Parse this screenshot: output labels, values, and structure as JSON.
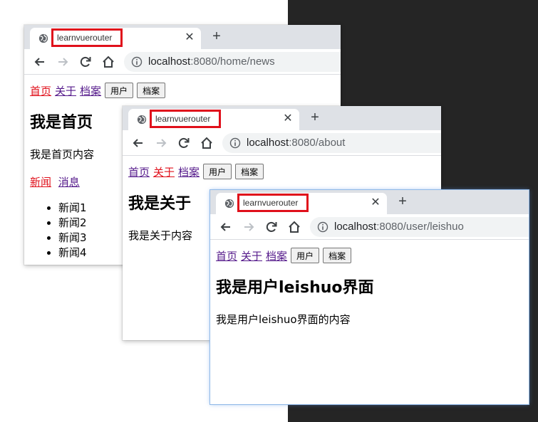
{
  "windows": [
    {
      "id": "home",
      "tab_title": "learnvuerouter",
      "url_host": "localhost",
      "url_rest": ":8080/home/news",
      "nav": {
        "home": "首页",
        "about": "关于",
        "archive": "档案",
        "user": "用户",
        "archive_btn": "档案"
      },
      "heading": "我是首页",
      "paragraph": "我是首页内容",
      "sub_nav": {
        "news": "新闻",
        "messages": "消息"
      },
      "news_items": [
        "新闻1",
        "新闻2",
        "新闻3",
        "新闻4"
      ]
    },
    {
      "id": "about",
      "tab_title": "learnvuerouter",
      "url_host": "localhost",
      "url_rest": ":8080/about",
      "nav": {
        "home": "首页",
        "about": "关于",
        "archive": "档案",
        "user": "用户",
        "archive_btn": "档案"
      },
      "heading": "我是关于",
      "paragraph": "我是关于内容"
    },
    {
      "id": "user",
      "tab_title": "learnvuerouter",
      "url_host": "localhost",
      "url_rest": ":8080/user/leishuo",
      "nav": {
        "home": "首页",
        "about": "关于",
        "archive": "档案",
        "user": "用户",
        "archive_btn": "档案"
      },
      "heading": "我是用户leishuo界面",
      "paragraph": "我是用户leishuo界面的内容"
    }
  ],
  "icons": {
    "tab_favicon": "globe-icon",
    "tab_close": "close-icon",
    "new_tab": "plus-icon",
    "back": "back-arrow-icon",
    "forward": "forward-arrow-icon",
    "reload": "reload-icon",
    "home": "home-icon",
    "site_info": "info-icon"
  },
  "colors": {
    "highlight_box": "#e0101b",
    "active_link": "#e0101b",
    "visited_link": "#551a8b",
    "tab_strip": "#dee1e6",
    "dark_background": "#252525"
  }
}
